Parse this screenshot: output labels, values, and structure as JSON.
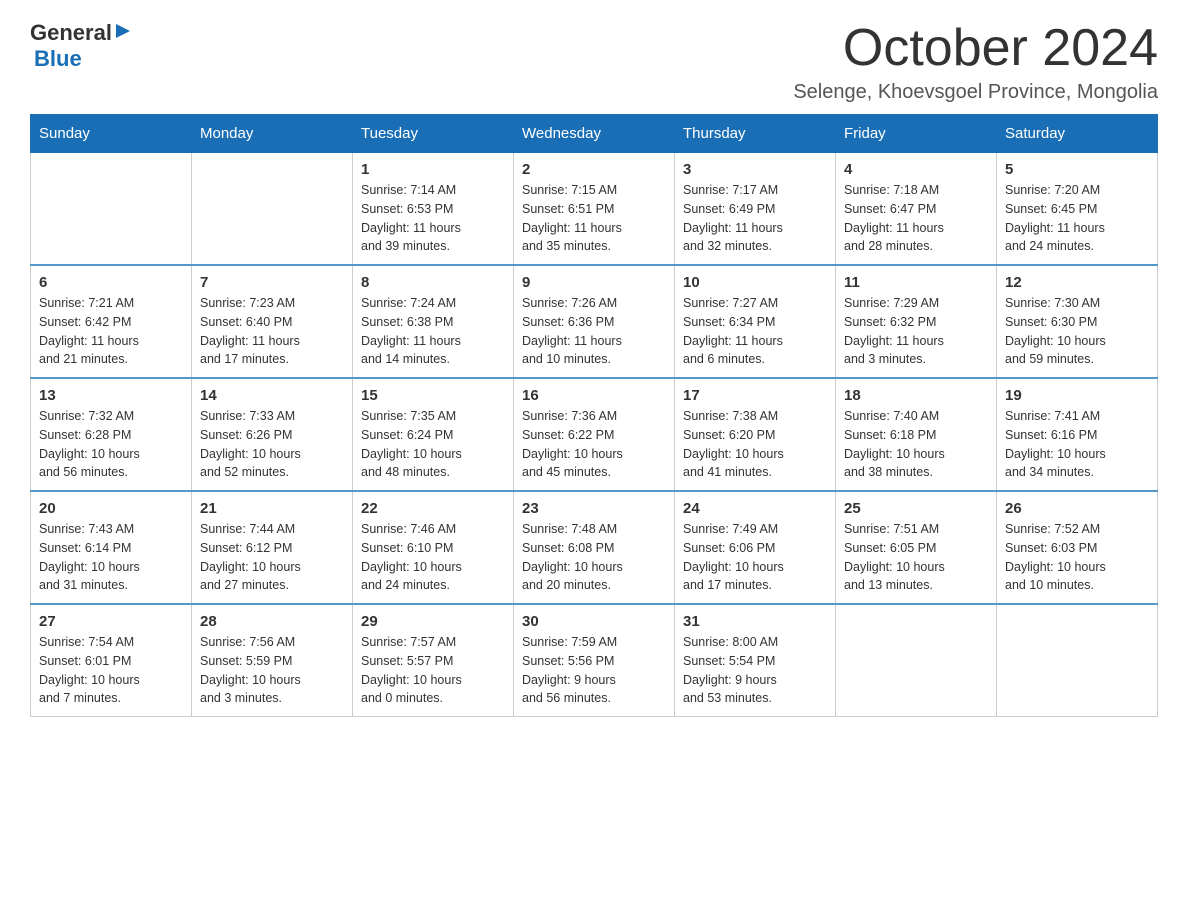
{
  "logo": {
    "general": "General",
    "blue": "Blue"
  },
  "title": "October 2024",
  "location": "Selenge, Khoevsgoel Province, Mongolia",
  "days_of_week": [
    "Sunday",
    "Monday",
    "Tuesday",
    "Wednesday",
    "Thursday",
    "Friday",
    "Saturday"
  ],
  "weeks": [
    [
      {
        "day": "",
        "info": ""
      },
      {
        "day": "",
        "info": ""
      },
      {
        "day": "1",
        "info": "Sunrise: 7:14 AM\nSunset: 6:53 PM\nDaylight: 11 hours\nand 39 minutes."
      },
      {
        "day": "2",
        "info": "Sunrise: 7:15 AM\nSunset: 6:51 PM\nDaylight: 11 hours\nand 35 minutes."
      },
      {
        "day": "3",
        "info": "Sunrise: 7:17 AM\nSunset: 6:49 PM\nDaylight: 11 hours\nand 32 minutes."
      },
      {
        "day": "4",
        "info": "Sunrise: 7:18 AM\nSunset: 6:47 PM\nDaylight: 11 hours\nand 28 minutes."
      },
      {
        "day": "5",
        "info": "Sunrise: 7:20 AM\nSunset: 6:45 PM\nDaylight: 11 hours\nand 24 minutes."
      }
    ],
    [
      {
        "day": "6",
        "info": "Sunrise: 7:21 AM\nSunset: 6:42 PM\nDaylight: 11 hours\nand 21 minutes."
      },
      {
        "day": "7",
        "info": "Sunrise: 7:23 AM\nSunset: 6:40 PM\nDaylight: 11 hours\nand 17 minutes."
      },
      {
        "day": "8",
        "info": "Sunrise: 7:24 AM\nSunset: 6:38 PM\nDaylight: 11 hours\nand 14 minutes."
      },
      {
        "day": "9",
        "info": "Sunrise: 7:26 AM\nSunset: 6:36 PM\nDaylight: 11 hours\nand 10 minutes."
      },
      {
        "day": "10",
        "info": "Sunrise: 7:27 AM\nSunset: 6:34 PM\nDaylight: 11 hours\nand 6 minutes."
      },
      {
        "day": "11",
        "info": "Sunrise: 7:29 AM\nSunset: 6:32 PM\nDaylight: 11 hours\nand 3 minutes."
      },
      {
        "day": "12",
        "info": "Sunrise: 7:30 AM\nSunset: 6:30 PM\nDaylight: 10 hours\nand 59 minutes."
      }
    ],
    [
      {
        "day": "13",
        "info": "Sunrise: 7:32 AM\nSunset: 6:28 PM\nDaylight: 10 hours\nand 56 minutes."
      },
      {
        "day": "14",
        "info": "Sunrise: 7:33 AM\nSunset: 6:26 PM\nDaylight: 10 hours\nand 52 minutes."
      },
      {
        "day": "15",
        "info": "Sunrise: 7:35 AM\nSunset: 6:24 PM\nDaylight: 10 hours\nand 48 minutes."
      },
      {
        "day": "16",
        "info": "Sunrise: 7:36 AM\nSunset: 6:22 PM\nDaylight: 10 hours\nand 45 minutes."
      },
      {
        "day": "17",
        "info": "Sunrise: 7:38 AM\nSunset: 6:20 PM\nDaylight: 10 hours\nand 41 minutes."
      },
      {
        "day": "18",
        "info": "Sunrise: 7:40 AM\nSunset: 6:18 PM\nDaylight: 10 hours\nand 38 minutes."
      },
      {
        "day": "19",
        "info": "Sunrise: 7:41 AM\nSunset: 6:16 PM\nDaylight: 10 hours\nand 34 minutes."
      }
    ],
    [
      {
        "day": "20",
        "info": "Sunrise: 7:43 AM\nSunset: 6:14 PM\nDaylight: 10 hours\nand 31 minutes."
      },
      {
        "day": "21",
        "info": "Sunrise: 7:44 AM\nSunset: 6:12 PM\nDaylight: 10 hours\nand 27 minutes."
      },
      {
        "day": "22",
        "info": "Sunrise: 7:46 AM\nSunset: 6:10 PM\nDaylight: 10 hours\nand 24 minutes."
      },
      {
        "day": "23",
        "info": "Sunrise: 7:48 AM\nSunset: 6:08 PM\nDaylight: 10 hours\nand 20 minutes."
      },
      {
        "day": "24",
        "info": "Sunrise: 7:49 AM\nSunset: 6:06 PM\nDaylight: 10 hours\nand 17 minutes."
      },
      {
        "day": "25",
        "info": "Sunrise: 7:51 AM\nSunset: 6:05 PM\nDaylight: 10 hours\nand 13 minutes."
      },
      {
        "day": "26",
        "info": "Sunrise: 7:52 AM\nSunset: 6:03 PM\nDaylight: 10 hours\nand 10 minutes."
      }
    ],
    [
      {
        "day": "27",
        "info": "Sunrise: 7:54 AM\nSunset: 6:01 PM\nDaylight: 10 hours\nand 7 minutes."
      },
      {
        "day": "28",
        "info": "Sunrise: 7:56 AM\nSunset: 5:59 PM\nDaylight: 10 hours\nand 3 minutes."
      },
      {
        "day": "29",
        "info": "Sunrise: 7:57 AM\nSunset: 5:57 PM\nDaylight: 10 hours\nand 0 minutes."
      },
      {
        "day": "30",
        "info": "Sunrise: 7:59 AM\nSunset: 5:56 PM\nDaylight: 9 hours\nand 56 minutes."
      },
      {
        "day": "31",
        "info": "Sunrise: 8:00 AM\nSunset: 5:54 PM\nDaylight: 9 hours\nand 53 minutes."
      },
      {
        "day": "",
        "info": ""
      },
      {
        "day": "",
        "info": ""
      }
    ]
  ]
}
